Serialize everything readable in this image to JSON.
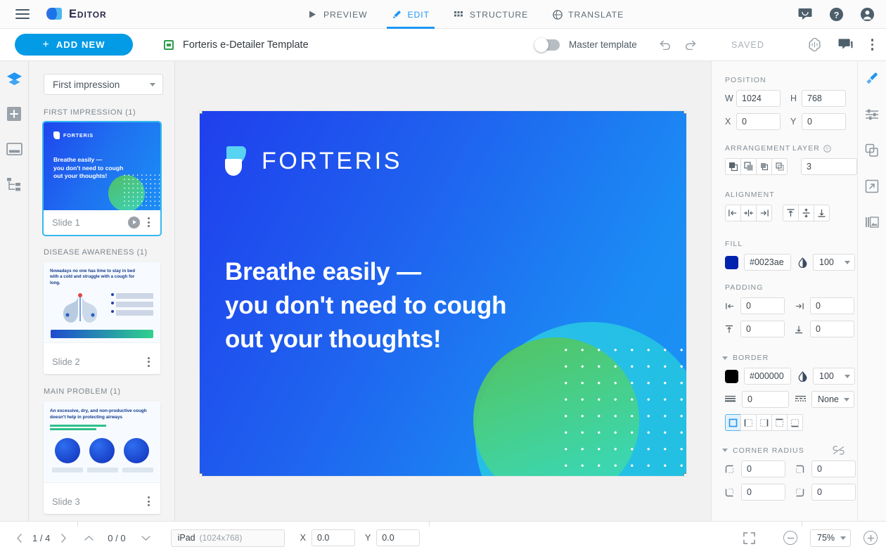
{
  "app": {
    "brand_name": "Editor",
    "menu_icon": "hamburger-icon",
    "logo_icon": "editor-logo-icon"
  },
  "topnav": {
    "items": [
      {
        "label": "PREVIEW",
        "icon": "play-icon",
        "active": false
      },
      {
        "label": "EDIT",
        "icon": "pencil-icon",
        "active": true
      },
      {
        "label": "STRUCTURE",
        "icon": "grid-icon",
        "active": false
      },
      {
        "label": "TRANSLATE",
        "icon": "globe-icon",
        "active": false
      }
    ],
    "right_icons": [
      {
        "name": "chat-icon"
      },
      {
        "name": "help-icon"
      },
      {
        "name": "account-icon"
      }
    ]
  },
  "subbar": {
    "add_new_label": "ADD NEW",
    "add_new_plus": "+",
    "document_title": "Forteris e-Detailer Template",
    "document_icon": "presentation-icon",
    "master_template_label": "Master template",
    "master_template_on": false,
    "undo_icon": "undo-icon",
    "redo_icon": "redo-icon",
    "save_status": "SAVED",
    "ai_icon": "ai-assistant-icon",
    "comment_icon": "comment-icon",
    "more_icon": "kebab-menu-icon"
  },
  "left_rail": [
    {
      "name": "layers-icon",
      "active": true
    },
    {
      "name": "add-slide-icon",
      "active": false
    },
    {
      "name": "layout-icon",
      "active": false
    },
    {
      "name": "tree-structure-icon",
      "active": false
    }
  ],
  "slides_panel": {
    "chapter_selected": "First impression",
    "groups": [
      {
        "label": "FIRST IMPRESSION (1)",
        "slides": [
          {
            "name": "Slide 1",
            "selected": true,
            "brand": "FORTERIS",
            "headline": "Breathe easily —\nyou don't need to cough\nout your thoughts!"
          }
        ]
      },
      {
        "label": "DISEASE AWARENESS (1)",
        "slides": [
          {
            "name": "Slide 2",
            "selected": false,
            "headline": "Nowadays no one has time to stay in bed with a cold and struggle with a cough for long."
          }
        ]
      },
      {
        "label": "MAIN PROBLEM (1)",
        "slides": [
          {
            "name": "Slide 3",
            "selected": false,
            "headline": "An excessive, dry, and non-productive cough doesn't help in protecting airways"
          }
        ]
      }
    ]
  },
  "canvas": {
    "brand": "FORTERIS",
    "headline": "Breathe easily —\nyou don't need to cough\nout your thoughts!",
    "background_color": "#1f4bee"
  },
  "properties": {
    "position": {
      "label": "POSITION",
      "w_label": "W",
      "w_value": "1024",
      "h_label": "H",
      "h_value": "768",
      "x_label": "X",
      "x_value": "0",
      "y_label": "Y",
      "y_value": "0"
    },
    "arrangement": {
      "label": "ARRANGEMENT",
      "buttons": [
        "bring-to-front",
        "send-to-back",
        "bring-forward",
        "send-backward"
      ]
    },
    "layer": {
      "label": "LAYER",
      "help_icon": "help-icon",
      "value": "3"
    },
    "alignment": {
      "label": "ALIGNMENT",
      "horizontal": [
        "align-left",
        "align-center-h",
        "align-right"
      ],
      "vertical": [
        "align-top",
        "align-center-v",
        "align-bottom"
      ]
    },
    "fill": {
      "label": "FILL",
      "color": "#0023ae",
      "color_text": "#0023ae",
      "opacity_icon": "opacity-icon",
      "opacity": "100"
    },
    "padding": {
      "label": "PADDING",
      "left": "0",
      "right": "0",
      "top": "0",
      "bottom": "0"
    },
    "border": {
      "label": "BORDER",
      "color": "#000000",
      "color_text": "#000000",
      "opacity": "100",
      "width": "0",
      "style": "None",
      "sides": [
        "all",
        "left",
        "right",
        "top",
        "bottom"
      ],
      "side_selected": "all"
    },
    "corner_radius": {
      "label": "CORNER RADIUS",
      "link_icon": "unlink-icon",
      "top_left": "0",
      "top_right": "0",
      "bottom_left": "0",
      "bottom_right": "0"
    }
  },
  "right_rail": [
    {
      "name": "style-brush-icon",
      "active": true
    },
    {
      "name": "settings-sliders-icon",
      "active": false
    },
    {
      "name": "duplicate-icon",
      "active": false
    },
    {
      "name": "external-link-icon",
      "active": false
    },
    {
      "name": "media-library-icon",
      "active": false
    }
  ],
  "statusbar": {
    "prev_icon": "chevron-left-icon",
    "page_indicator": "1 / 4",
    "next_icon": "chevron-right-icon",
    "up_icon": "chevron-up-icon",
    "sub_indicator": "0 / 0",
    "down_icon": "chevron-down-icon",
    "device_name": "iPad",
    "device_dimensions": "(1024x768)",
    "x_label": "X",
    "x_value": "0.0",
    "y_label": "Y",
    "y_value": "0.0",
    "fit_icon": "fit-to-screen-icon",
    "zoom_out_icon": "zoom-out-icon",
    "zoom_value": "75%",
    "zoom_in_icon": "zoom-in-icon"
  }
}
